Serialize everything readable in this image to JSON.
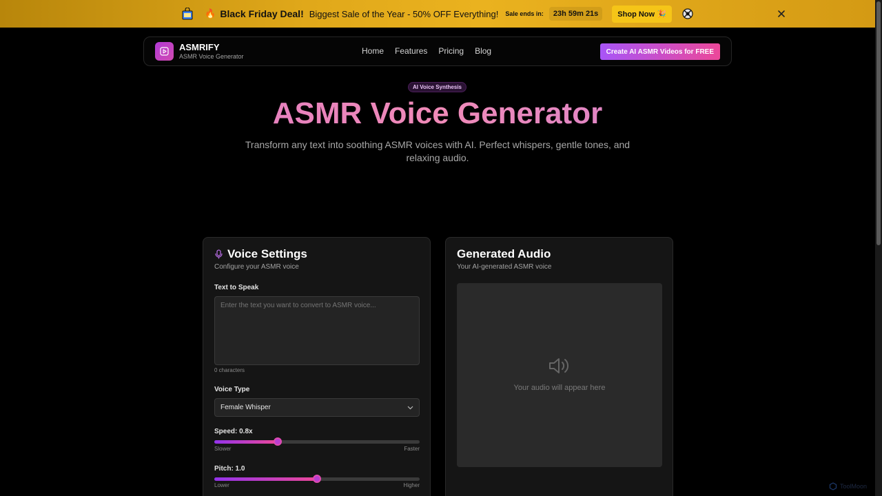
{
  "promo": {
    "fire": "🔥",
    "deal": "Black Friday Deal!",
    "subtitle": "Biggest Sale of the Year - 50% OFF Everything!",
    "ends_label": "Sale ends in:",
    "timer": "23h 59m 21s",
    "shop_label": "Shop Now 🎉"
  },
  "nav": {
    "brand_name": "ASMRIFY",
    "brand_sub": "ASMR Voice Generator",
    "links": [
      "Home",
      "Features",
      "Pricing",
      "Blog"
    ],
    "cta": "Create AI ASMR Videos for FREE"
  },
  "hero": {
    "badge": "AI Voice Synthesis",
    "title": "ASMR Voice Generator",
    "subtitle": "Transform any text into soothing ASMR voices with AI. Perfect whispers, gentle tones, and relaxing audio."
  },
  "settings": {
    "title": "Voice Settings",
    "subtitle": "Configure your ASMR voice",
    "text_label": "Text to Speak",
    "text_placeholder": "Enter the text you want to convert to ASMR voice...",
    "text_value": "",
    "char_count": "0 characters",
    "voice_label": "Voice Type",
    "voice_value": "Female Whisper",
    "speed_label": "Speed: 0.8x",
    "speed_fraction": 0.31,
    "speed_min": "Slower",
    "speed_max": "Faster",
    "pitch_label": "Pitch: 1.0",
    "pitch_fraction": 0.5,
    "pitch_min": "Lower",
    "pitch_max": "Higher"
  },
  "audio": {
    "title": "Generated Audio",
    "subtitle": "Your AI-generated ASMR voice",
    "empty": "Your audio will appear here"
  },
  "watermark": "ToolMoon",
  "colors": {
    "accent_purple": "#a855f7",
    "accent_pink": "#ec4899",
    "banner_gold": "#e0a81a",
    "background": "#000000",
    "card": "#151515"
  }
}
